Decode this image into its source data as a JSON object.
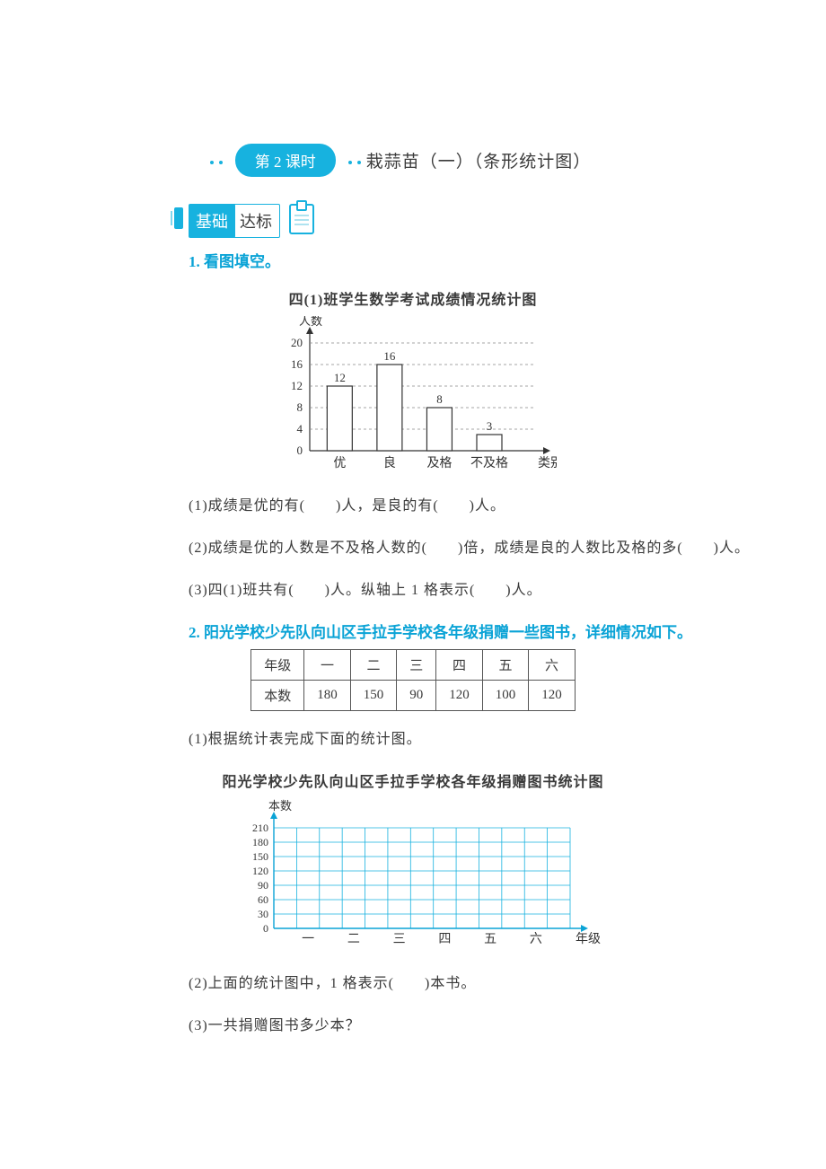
{
  "lesson": {
    "pill": "第 2 课时",
    "title": "栽蒜苗（一）（条形统计图）"
  },
  "badges": {
    "jichu": "基础",
    "dabiao": "达标"
  },
  "q1": {
    "heading": "1. 看图填空。",
    "chart_title": "四(1)班学生数学考试成绩情况统计图",
    "sub1": "(1)成绩是优的有(　　)人，是良的有(　　)人。",
    "sub2": "(2)成绩是优的人数是不及格人数的(　　)倍，成绩是良的人数比及格的多(　　)人。",
    "sub3": "(3)四(1)班共有(　　)人。纵轴上 1 格表示(　　)人。",
    "yaxis": "人数",
    "xaxis": "类别",
    "yticks": [
      "0",
      "4",
      "8",
      "12",
      "16",
      "20"
    ]
  },
  "q2": {
    "heading": "2. 阳光学校少先队向山区手拉手学校各年级捐赠一些图书，详细情况如下。",
    "table_header": "年级",
    "table_row_label": "本数",
    "sub1": "(1)根据统计表完成下面的统计图。",
    "chart_title": "阳光学校少先队向山区手拉手学校各年级捐赠图书统计图",
    "yaxis": "本数",
    "xaxis": "年级",
    "yticks": [
      "0",
      "30",
      "60",
      "90",
      "120",
      "150",
      "180",
      "210"
    ],
    "sub2": "(2)上面的统计图中，1 格表示(　　)本书。",
    "sub3": "(3)一共捐赠图书多少本？"
  },
  "chart_data": [
    {
      "type": "bar",
      "title": "四(1)班学生数学考试成绩情况统计图",
      "categories": [
        "优",
        "良",
        "及格",
        "不及格"
      ],
      "values": [
        12,
        16,
        8,
        3
      ],
      "xlabel": "类别",
      "ylabel": "人数",
      "ylim": [
        0,
        20
      ],
      "ystep": 4
    },
    {
      "type": "bar",
      "title": "阳光学校少先队向山区手拉手学校各年级捐赠图书统计图",
      "categories": [
        "一",
        "二",
        "三",
        "四",
        "五",
        "六"
      ],
      "values": [
        180,
        150,
        90,
        120,
        100,
        120
      ],
      "xlabel": "年级",
      "ylabel": "本数",
      "ylim": [
        0,
        210
      ],
      "ystep": 30,
      "note": "blank grid for student to complete"
    }
  ]
}
